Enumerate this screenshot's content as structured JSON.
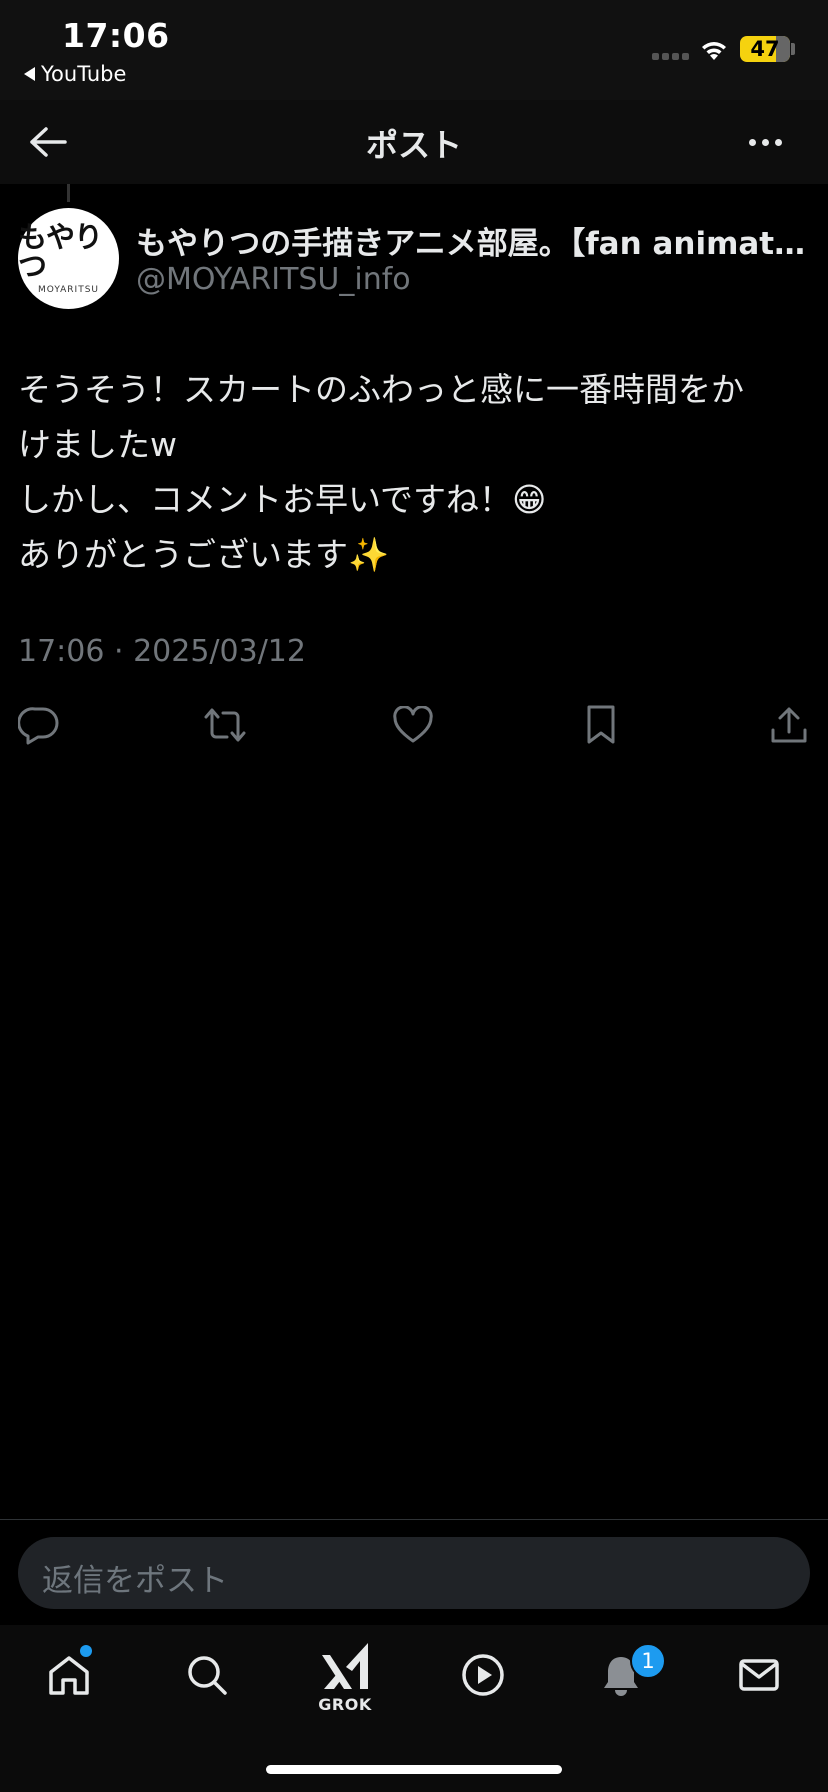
{
  "status_bar": {
    "time": "17:06",
    "back_app": "YouTube",
    "battery": "47"
  },
  "header": {
    "title": "ポスト"
  },
  "post": {
    "author_name": "もやりつの手描きアニメ部屋。【fan animati...",
    "author_handle": "@MOYARITSU_info",
    "avatar_logo": "もやりつ",
    "avatar_sub": "MOYARITSU",
    "text_lines": [
      "そうそう！スカートのふわっと感に一番時間をか",
      "けましたw",
      "しかし、コメントお早いですね！😁",
      "ありがとうございます✨"
    ],
    "timestamp": "17:06 · 2025/03/12"
  },
  "actions": [
    "reply-icon",
    "retweet-icon",
    "like-icon",
    "bookmark-icon",
    "share-icon"
  ],
  "reply": {
    "placeholder": "返信をポスト"
  },
  "tab_bar": {
    "grok_label": "GROK",
    "notification_count": "1"
  }
}
